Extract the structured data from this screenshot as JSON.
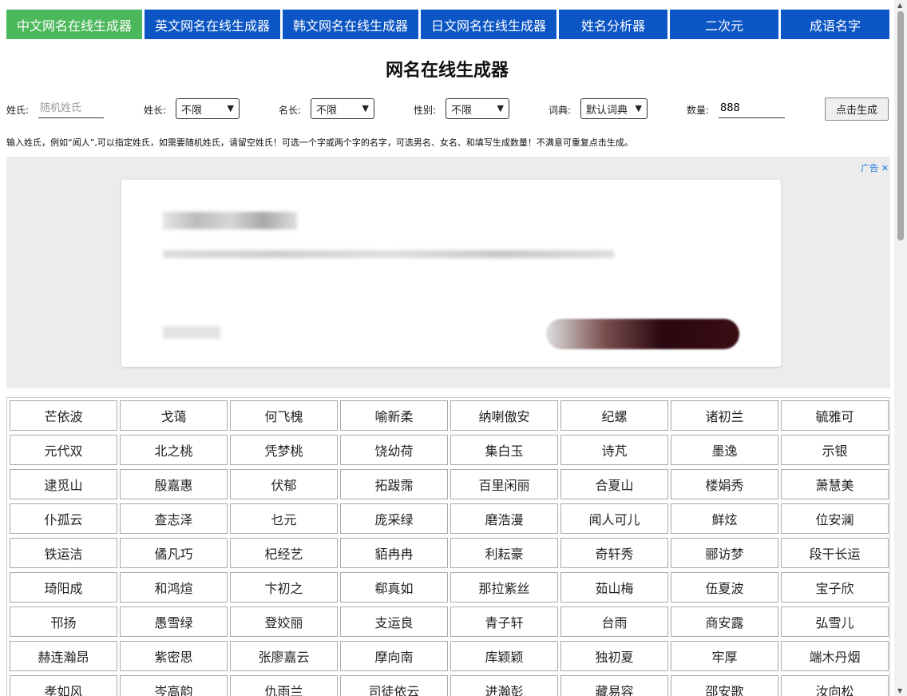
{
  "nav": {
    "tabs": [
      {
        "label": "中文网名在线生成器"
      },
      {
        "label": "英文网名在线生成器"
      },
      {
        "label": "韩文网名在线生成器"
      },
      {
        "label": "日文网名在线生成器"
      },
      {
        "label": "姓名分析器"
      },
      {
        "label": "二次元"
      },
      {
        "label": "成语名字"
      }
    ],
    "active_index": 0,
    "colors": {
      "active": "#4cb85c",
      "default": "#0b55c4"
    }
  },
  "page_title": "网名在线生成器",
  "form": {
    "surname_label": "姓氏:",
    "surname_placeholder": "随机姓氏",
    "surname_length_label": "姓长:",
    "surname_length_value": "不限",
    "name_length_label": "名长:",
    "name_length_value": "不限",
    "gender_label": "性别:",
    "gender_value": "不限",
    "dict_label": "词典:",
    "dict_value": "默认词典",
    "count_label": "数量:",
    "count_value": "888",
    "generate_label": "点击生成"
  },
  "hint": "输入姓氏，例如“闻人”,可以指定姓氏，如需要随机姓氏，请留空姓氏！可选一个字或两个字的名字，可选男名、女名、和填写生成数量！不满意可重复点击生成。",
  "ad": {
    "label": "广告",
    "close": "✕"
  },
  "names": [
    "芒依波",
    "戈蔼",
    "何飞槐",
    "喻新柔",
    "纳喇傲安",
    "纪螺",
    "诸初兰",
    "毓雅可",
    "元代双",
    "北之桃",
    "凭梦桃",
    "饶幼荷",
    "集白玉",
    "诗芃",
    "墨逸",
    "示银",
    "逮觅山",
    "殷嘉惠",
    "伏郁",
    "拓跋霈",
    "百里闲丽",
    "合夏山",
    "楼娟秀",
    "萧慧美",
    "仆孤云",
    "查志泽",
    "乜元",
    "庞采绿",
    "磨浩漫",
    "闻人可儿",
    "鲜炫",
    "位安澜",
    "铁运洁",
    "僪凡巧",
    "杞经艺",
    "貊冉冉",
    "利耘豪",
    "奇轩秀",
    "郦访梦",
    "段干长运",
    "琦阳成",
    "和鸿煊",
    "卞初之",
    "郗真如",
    "那拉紫丝",
    "茹山梅",
    "伍夏波",
    "宝子欣",
    "邗扬",
    "愚雪绿",
    "登姣丽",
    "支运良",
    "青子轩",
    "台雨",
    "商安露",
    "弘雪儿",
    "赫连瀚昂",
    "紫密思",
    "张廖嘉云",
    "摩向南",
    "库颖颖",
    "独初夏",
    "牢厚",
    "端木丹烟",
    "孝如风",
    "岑高韵",
    "仇雨兰",
    "司徒依云",
    "进瀚彭",
    "藏易容",
    "邵安歌",
    "汝向松"
  ]
}
